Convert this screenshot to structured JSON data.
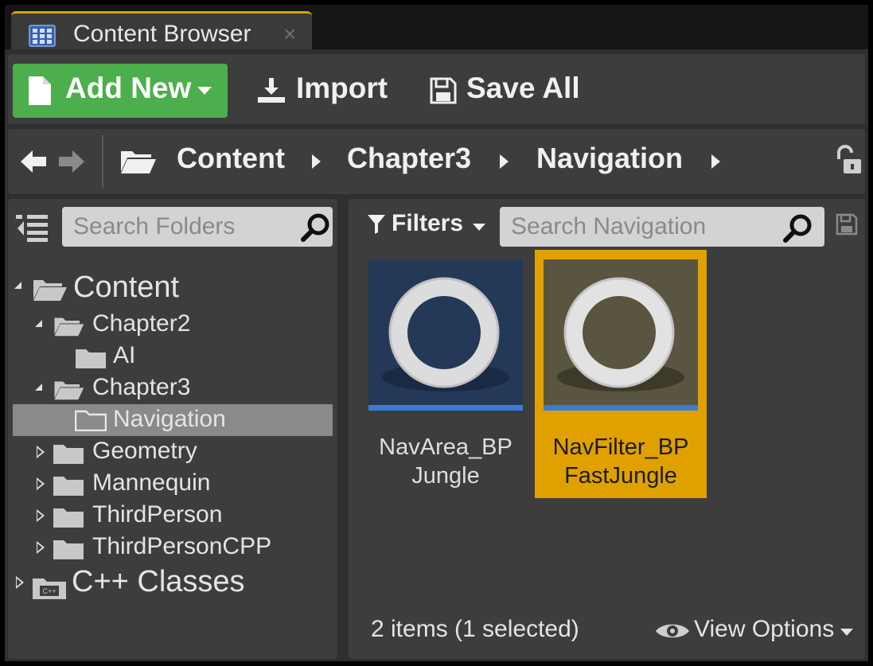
{
  "tab": {
    "title": "Content Browser",
    "close": "×"
  },
  "toolbar": {
    "add_new": "Add New",
    "import": "Import",
    "save_all": "Save All"
  },
  "path": {
    "crumbs": [
      "Content",
      "Chapter3",
      "Navigation"
    ]
  },
  "folders": {
    "search_placeholder": "Search Folders",
    "tree": [
      {
        "label": "Content",
        "state": "expanded"
      },
      {
        "label": "Chapter2",
        "state": "expanded"
      },
      {
        "label": "AI",
        "state": "leaf"
      },
      {
        "label": "Chapter3",
        "state": "expanded"
      },
      {
        "label": "Navigation",
        "state": "leaf",
        "selected": true
      },
      {
        "label": "Geometry",
        "state": "collapsed"
      },
      {
        "label": "Mannequin",
        "state": "collapsed"
      },
      {
        "label": "ThirdPerson",
        "state": "collapsed"
      },
      {
        "label": "ThirdPersonCPP",
        "state": "collapsed"
      },
      {
        "label": "C++ Classes",
        "state": "collapsed",
        "icon": "cpp-folder-icon"
      }
    ]
  },
  "assets": {
    "filters_label": "Filters",
    "search_placeholder": "Search Navigation",
    "items": [
      {
        "name": "NavArea_BP\nJungle",
        "thumb_color": "#243858",
        "selected": false
      },
      {
        "name": "NavFilter_BP\nFastJungle",
        "thumb_color": "#5a5540",
        "selected": true
      }
    ],
    "status": "2 items (1 selected)",
    "view_options": "View Options"
  },
  "colors": {
    "accent_tab": "#d8a200",
    "add_new": "#4cae4c",
    "selection": "#e0a100",
    "asset_bar": "#3a7bd5"
  }
}
